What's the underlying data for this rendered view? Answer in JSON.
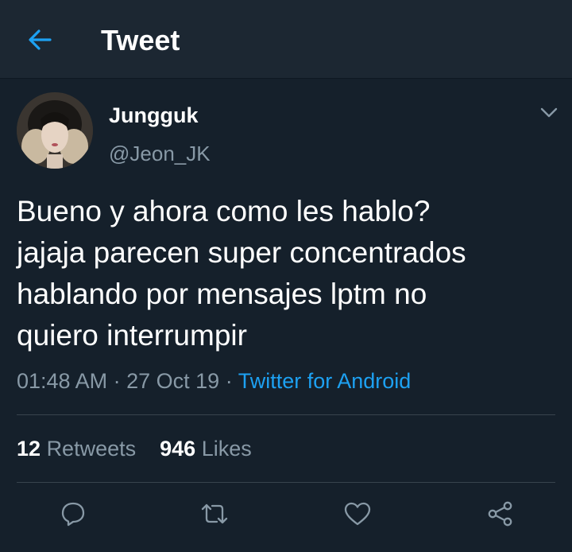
{
  "header": {
    "title": "Tweet",
    "back_icon": "arrow-left-icon",
    "accent": "#1da1f2",
    "background": "#1c2732"
  },
  "author": {
    "name": "Jungguk",
    "handle": "@Jeon_JK"
  },
  "tweet": {
    "lines": [
      "Bueno y ahora como les hablo?",
      "jajaja parecen super concentrados",
      "hablando por mensajes lptm no",
      "quiero interrumpir"
    ]
  },
  "meta": {
    "time": "01:48 AM",
    "date": "27 Oct 19",
    "separator": "·",
    "source": "Twitter for Android"
  },
  "stats": {
    "retweets_count": "12",
    "retweets_label": "Retweets",
    "likes_count": "946",
    "likes_label": "Likes"
  },
  "actions": [
    "reply-icon",
    "retweet-icon",
    "like-icon",
    "share-icon"
  ],
  "colors": {
    "background": "#15202b",
    "secondary_text": "#8899a6",
    "divider": "#38444d"
  }
}
